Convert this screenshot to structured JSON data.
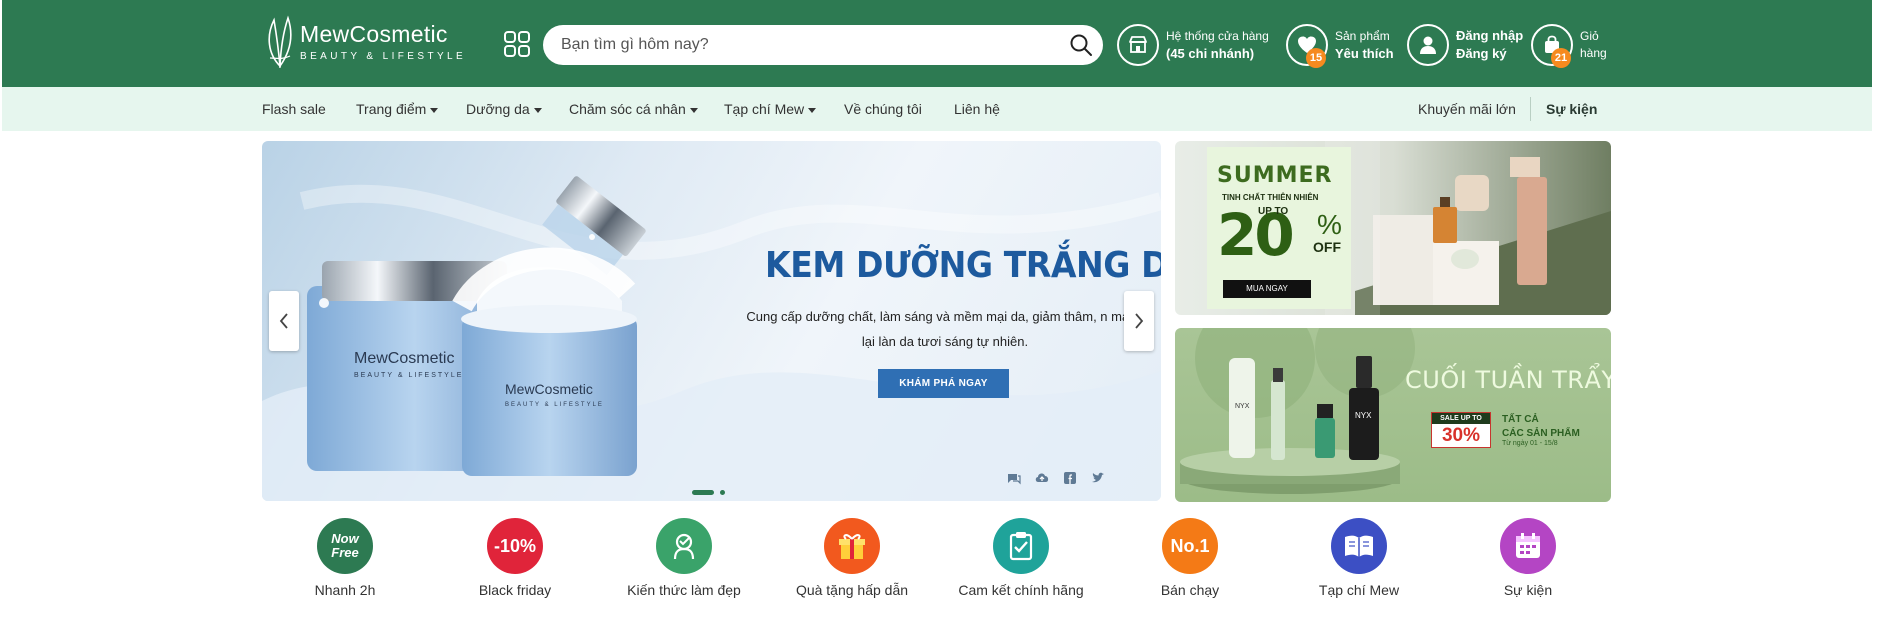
{
  "header": {
    "logo_name": "MewCosmetic",
    "logo_tagline": "BEAUTY & LIFESTYLE",
    "search_placeholder": "Bạn tìm gì hôm nay?",
    "stores_line1": "Hệ thống cửa hàng",
    "stores_line2": "(45 chi nhánh)",
    "wishlist_line1": "Sản phẩm",
    "wishlist_line2": "Yêu thích",
    "wishlist_count": "15",
    "login_line1": "Đăng nhập",
    "login_line2": "Đăng ký",
    "cart_line1": "Giỏ",
    "cart_line2": "hàng",
    "cart_count": "21"
  },
  "nav": {
    "items": [
      {
        "label": "Flash sale"
      },
      {
        "label": "Trang điểm"
      },
      {
        "label": "Dưỡng da"
      },
      {
        "label": "Chăm sóc cá nhân"
      },
      {
        "label": "Tạp chí Mew"
      },
      {
        "label": "Về chúng tôi"
      },
      {
        "label": "Liên hệ"
      }
    ],
    "promo": "Khuyến mãi lớn",
    "events": "Sự kiện"
  },
  "hero": {
    "title": "KEM DƯỠNG TRẮNG DA",
    "description": "Cung cấp dưỡng chất, làm sáng và mềm mại da, giảm thâm, n mang lại làn da tươi sáng tự nhiên.",
    "cta": "KHÁM PHÁ NGAY",
    "jar_brand": "MewCosmetic",
    "jar_tagline": "BEAUTY & LIFESTYLE",
    "slide_index": 1,
    "slide_count": 2
  },
  "side_banner_1": {
    "title": "SUMMER",
    "subtitle": "TINH CHẤT THIÊN NHIÊN",
    "upto": "UP TO",
    "value": "20",
    "percent": "%",
    "off": "OFF",
    "button": "MUA NGAY"
  },
  "side_banner_2": {
    "title": "CUỐI TUẦN TRẨY HỘI",
    "sale_label": "SALE UP TO",
    "sale_value": "30%",
    "sale_text_1": "TẤT CẢ",
    "sale_text_2": "CÁC SẢN PHẨM",
    "date": "Từ ngày 01 - 15/8",
    "product_brand": "NYX"
  },
  "categories": [
    {
      "label": "Nhanh 2h",
      "icon": "now-free-icon",
      "icon_text_1": "Now",
      "icon_text_2": "Free",
      "color": "#2d7a52"
    },
    {
      "label": "Black friday",
      "icon": "discount-icon",
      "icon_text_1": "-10%",
      "color": "#e0243a"
    },
    {
      "label": "Kiến thức làm đẹp",
      "icon": "beauty-knowledge-icon",
      "color": "#3aa36a"
    },
    {
      "label": "Quà tặng hấp dẫn",
      "icon": "gift-icon",
      "color": "#f2591e"
    },
    {
      "label": "Cam kết chính hãng",
      "icon": "clipboard-check-icon",
      "color": "#1fa39a"
    },
    {
      "label": "Bán chạy",
      "icon": "number-one-icon",
      "icon_text_1": "No.1",
      "color": "#f47a16"
    },
    {
      "label": "Tạp chí Mew",
      "icon": "book-icon",
      "color": "#3c4fc4"
    },
    {
      "label": "Sự kiện",
      "icon": "calendar-icon",
      "color": "#b445c4"
    }
  ],
  "colors": {
    "brand_green": "#2d7a52",
    "nav_bg": "#e6f6ee",
    "badge_orange": "#f68a1f",
    "hero_title_blue": "#1d5a9e",
    "hero_button_blue": "#2f6fb4"
  }
}
